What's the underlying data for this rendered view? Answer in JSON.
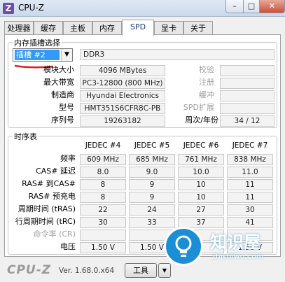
{
  "window": {
    "title": "CPU-Z",
    "min": "–",
    "max": "□",
    "close": "✕",
    "icon": "Z"
  },
  "tabs": [
    "处理器",
    "缓存",
    "主板",
    "内存",
    "SPD",
    "显卡",
    "关于"
  ],
  "slot_group": {
    "title": "内存插槽选择",
    "selected_slot": "插槽 #2",
    "memory_type": "DDR3",
    "labels": {
      "module_size": "模块大小",
      "max_bandwidth": "最大带宽",
      "manufacturer": "制造商",
      "part_number": "型号",
      "serial_number": "序列号",
      "correction": "校验",
      "registered": "注册",
      "buffered": "缓冲",
      "spd_ext": "SPD扩展",
      "week_year": "周次/年份"
    },
    "values": {
      "module_size": "4096 MBytes",
      "max_bandwidth": "PC3-12800 (800 MHz)",
      "manufacturer": "Hyundai Electronics",
      "part_number": "HMT351S6CFR8C-PB",
      "serial_number": "19263182",
      "week_year": "34 / 12"
    }
  },
  "timing_group": {
    "title": "时序表",
    "columns": [
      "JEDEC #4",
      "JEDEC #5",
      "JEDEC #6",
      "JEDEC #7"
    ],
    "rows": [
      {
        "label": "频率",
        "values": [
          "609 MHz",
          "685 MHz",
          "761 MHz",
          "838 MHz"
        ],
        "muted": false
      },
      {
        "label": "CAS# 延迟",
        "values": [
          "8.0",
          "9.0",
          "10.0",
          "11.0"
        ],
        "muted": false
      },
      {
        "label": "RAS# 到CAS#",
        "values": [
          "8",
          "9",
          "10",
          "11"
        ],
        "muted": false
      },
      {
        "label": "RAS# 预充电",
        "values": [
          "8",
          "9",
          "10",
          "11"
        ],
        "muted": false
      },
      {
        "label": "周期时间 (tRAS)",
        "values": [
          "22",
          "24",
          "27",
          "30"
        ],
        "muted": false
      },
      {
        "label": "行周期时间 (tRC)",
        "values": [
          "30",
          "33",
          "37",
          "41"
        ],
        "muted": false
      },
      {
        "label": "命令率 (CR)",
        "values": [
          "",
          "",
          "",
          ""
        ],
        "muted": true
      },
      {
        "label": "电压",
        "values": [
          "1.50 V",
          "1.50 V",
          "",
          "1.50 V"
        ],
        "muted": false
      }
    ]
  },
  "bottom": {
    "logo": "CPU-Z",
    "version": "Ver. 1.68.0.x64",
    "tools_button": "工具",
    "tools_arrow": "▼"
  },
  "watermark": {
    "text": "知识屋",
    "sub": "zhishiwu.com"
  },
  "colors": {
    "accent": "#3399ff",
    "underline": "#e02020",
    "watermark": "#1b8fd6"
  }
}
